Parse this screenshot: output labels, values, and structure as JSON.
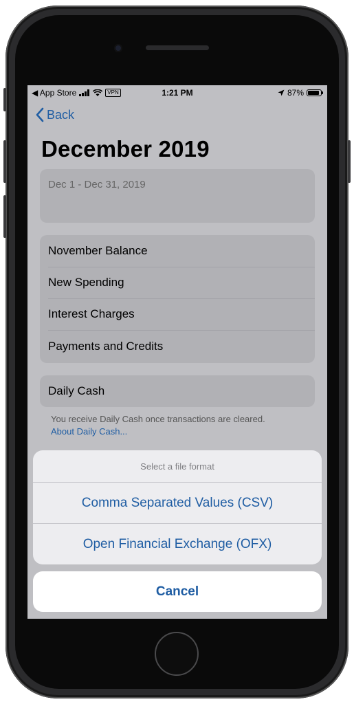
{
  "status_bar": {
    "carrier": "◀ App Store",
    "vpn": "VPN",
    "time": "1:21 PM",
    "battery_text": "87%"
  },
  "nav": {
    "back_label": "Back"
  },
  "page": {
    "title": "December 2019"
  },
  "period": {
    "range": "Dec 1 - Dec 31, 2019"
  },
  "summary_rows": [
    {
      "label": "November Balance"
    },
    {
      "label": "New Spending"
    },
    {
      "label": "Interest Charges"
    },
    {
      "label": "Payments and Credits"
    }
  ],
  "daily_cash": {
    "label": "Daily Cash",
    "note": "You receive Daily Cash once transactions are cleared.",
    "link": "About Daily Cash..."
  },
  "action_sheet": {
    "title": "Select a file format",
    "options": [
      {
        "label": "Comma Separated Values (CSV)"
      },
      {
        "label": "Open Financial Exchange (OFX)"
      }
    ],
    "cancel_label": "Cancel"
  },
  "colors": {
    "accent": "#1f5da3",
    "dimmed_background": "#bfbfc3",
    "sheet_background": "#ededf0",
    "phone_frame": "#2b2b2d"
  },
  "icons": [
    "signal-icon",
    "wifi-icon",
    "location-icon",
    "battery-icon",
    "chevron-left-icon"
  ]
}
